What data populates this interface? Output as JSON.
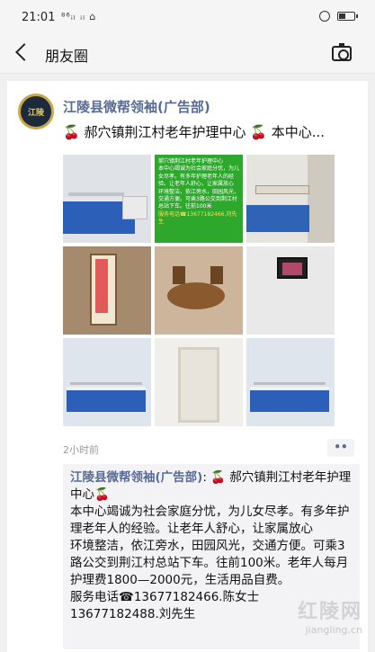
{
  "status_bar": {
    "time": "21:01",
    "signal_text": "⁸⁶ᵢₗ ᵢₗ ⌂"
  },
  "nav": {
    "title": "朋友圈"
  },
  "post": {
    "avatar_text": "江陵",
    "author": "江陵县微帮领袖(广告部)",
    "headline_cherry": "🍒",
    "headline_text": "郝穴镇荆江村老年护理中心",
    "headline_tail": "本中心...",
    "poster_lines": [
      "郝穴镇荆江村老年护理中心",
      "本中心竭诚为社会家庭分忧，为儿女尽孝。有多年护理老年人的经验。让老年人舒心，让家属放心",
      "环境整洁，依江旁水，田园风光，交通方便。可乘3路公交到荆江村总站下车。往前100米",
      "服务电话☎13677182466.刘先生"
    ],
    "time_ago": "2小时前",
    "more": "••",
    "comment": {
      "name": "江陵县微帮领袖(广告部)",
      "colon": ": ",
      "cherry": "🍒",
      "title": " 郝穴镇荆江村老年护理中心",
      "line1": "本中心竭诚为社会家庭分忧，为儿女尽孝。有多年护理老年人的经验。让老年人舒心，让家属放心",
      "line2": "环境整洁，依江旁水，田园风光，交通方便。可乘3路公交到荆江村总站下车。往前100米。老年人每月护理费1800—2000元，生活用品自费。",
      "line3": "服务电话☎13677182466.陈女士",
      "line4": "13677182488.刘先生"
    }
  },
  "watermark": {
    "main": "红陵网",
    "url": "jiangling.cn"
  },
  "colors": {
    "link_blue": "#576b95",
    "poster_green": "#2da82d",
    "bed_blue": "#2b5fb8"
  }
}
